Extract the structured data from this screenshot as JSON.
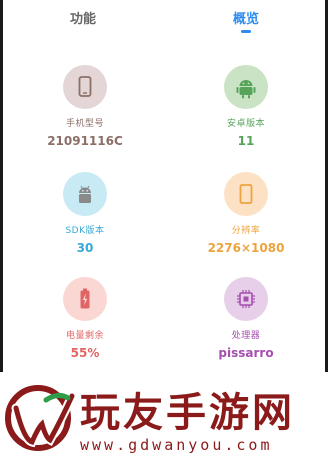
{
  "tabs": [
    {
      "label": "功能"
    },
    {
      "label": "概览"
    }
  ],
  "cards": [
    {
      "label": "手机型号",
      "value": "21091116C",
      "icon": "phone-icon",
      "bg": "#e4d6d6",
      "label_color": "#8b6f66",
      "value_color": "#8b6f66"
    },
    {
      "label": "安卓版本",
      "value": "11",
      "icon": "android-icon",
      "bg": "#c9e3c4",
      "label_color": "#58a35a",
      "value_color": "#58a35a"
    },
    {
      "label": "SDK版本",
      "value": "30",
      "icon": "sdk-android-icon",
      "bg": "#c7eaf5",
      "label_color": "#36a9d8",
      "value_color": "#36a9d8"
    },
    {
      "label": "分辨率",
      "value": "2276×1080",
      "icon": "screen-icon",
      "bg": "#fde1c4",
      "label_color": "#eca43f",
      "value_color": "#eca43f"
    },
    {
      "label": "电量剩余",
      "value": "55%",
      "icon": "battery-icon",
      "bg": "#fbd7d4",
      "label_color": "#e16565",
      "value_color": "#e16565"
    },
    {
      "label": "处理器",
      "value": "pissarro",
      "icon": "chip-icon",
      "bg": "#e8cfe9",
      "label_color": "#a54fb0",
      "value_color": "#a54fb0"
    }
  ],
  "watermark": {
    "name": "玩友手游网",
    "url": "www.gdwanyou.com",
    "color": "#8b1a1a"
  }
}
